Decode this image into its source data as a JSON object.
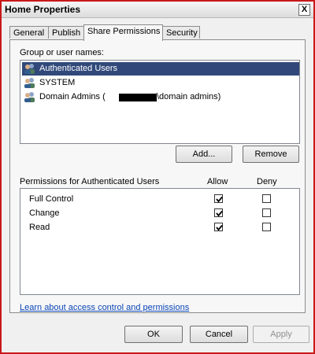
{
  "window": {
    "title": "Home Properties",
    "close_symbol": "X"
  },
  "tabs": [
    {
      "label": "General",
      "active": false
    },
    {
      "label": "Publish",
      "active": false
    },
    {
      "label": "Share Permissions",
      "active": true
    },
    {
      "label": "Security",
      "active": false
    }
  ],
  "users_section": {
    "label": "Group or user names:",
    "items": [
      {
        "name": "Authenticated Users",
        "icon": "user-group-icon",
        "selected": true
      },
      {
        "name": "SYSTEM",
        "icon": "user-group-icon",
        "selected": false
      },
      {
        "name": "Domain Admins (",
        "suffix": "\\domain admins)",
        "icon": "user-group-icon",
        "selected": false
      }
    ],
    "add_button": "Add...",
    "remove_button": "Remove"
  },
  "permissions_section": {
    "label": "Permissions for Authenticated Users",
    "allow_header": "Allow",
    "deny_header": "Deny",
    "items": [
      {
        "name": "Full Control",
        "allow": true,
        "deny": false
      },
      {
        "name": "Change",
        "allow": true,
        "deny": false
      },
      {
        "name": "Read",
        "allow": true,
        "deny": false
      }
    ]
  },
  "help_link": "Learn about access control and permissions",
  "footer": {
    "ok": "OK",
    "cancel": "Cancel",
    "apply": "Apply"
  }
}
